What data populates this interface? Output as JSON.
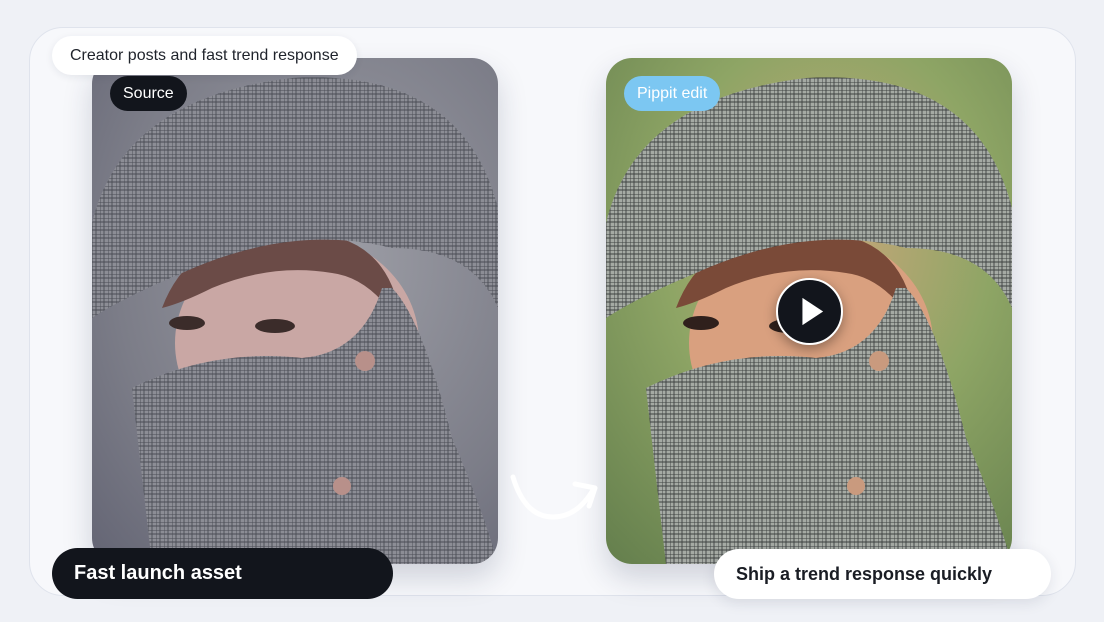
{
  "header": {
    "caption": "Creator posts and fast trend response"
  },
  "panels": {
    "source": {
      "tag": "Source",
      "image": "person-wide-brim-hat-plaid-face-cover"
    },
    "edit": {
      "tag": "Pippit edit",
      "image": "person-wide-brim-hat-plaid-face-cover-enhanced"
    }
  },
  "labels": {
    "left": "Fast launch asset",
    "right": "Ship a trend response quickly"
  },
  "icons": {
    "play": "play-icon",
    "arrow": "curved-arrow-icon"
  },
  "colors": {
    "dark": "#12151c",
    "edit_tag": "#7cc7f2",
    "background": "#eff1f6"
  }
}
